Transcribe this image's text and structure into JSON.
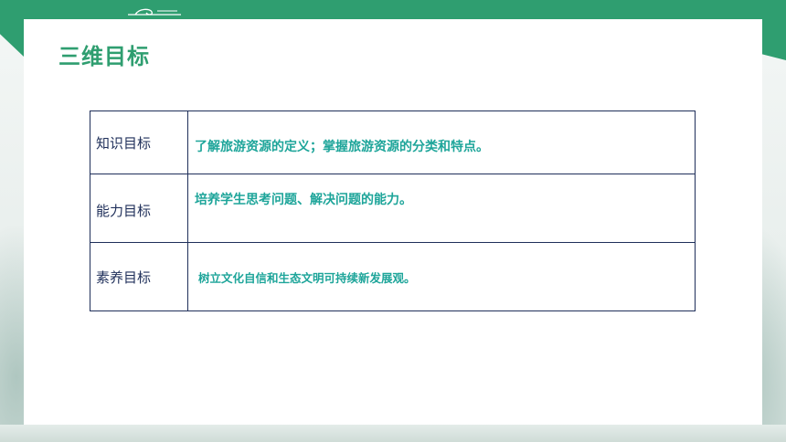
{
  "slide": {
    "title": "三维目标",
    "theme_color": "#2f9e70",
    "text_accent": "#1ea59a"
  },
  "goals": [
    {
      "label": "知识目标",
      "content": "了解旅游资源的定义；掌握旅游资源的分类和特点。"
    },
    {
      "label": "能力目标",
      "content": "培养学生思考问题、解决问题的能力。"
    },
    {
      "label": "素养目标",
      "content": "树立文化自信和生态文明可持续新发展观。"
    }
  ]
}
